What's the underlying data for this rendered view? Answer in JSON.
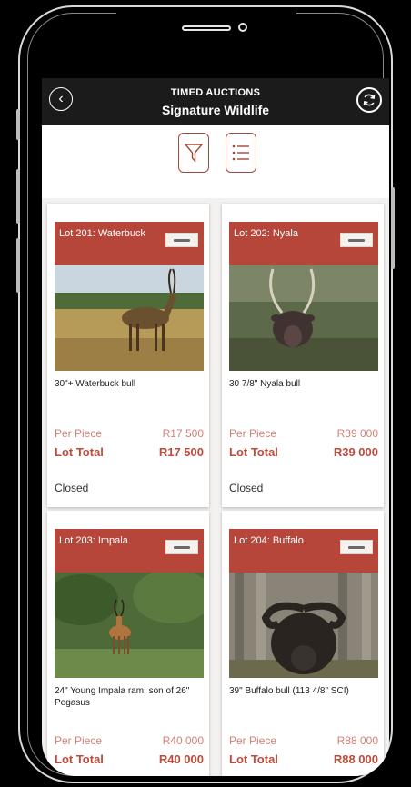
{
  "header": {
    "subtitle": "TIMED AUCTIONS",
    "title": "Signature Wildlife",
    "back_icon": "back-arrow-icon",
    "refresh_icon": "refresh-icon"
  },
  "toolbar": {
    "filter_icon": "filter-icon",
    "list_icon": "list-view-icon"
  },
  "colors": {
    "accent": "#b7463a",
    "header_bg": "#1b1b1b",
    "price": "#c04a3a"
  },
  "lots": [
    {
      "title": "Lot 201: Waterbuck",
      "description": "30\"+ Waterbuck bull",
      "per_piece_label": "Per Piece",
      "per_piece_value": "R17 500",
      "lot_total_label": "Lot Total",
      "lot_total_value": "R17 500",
      "status": "Closed"
    },
    {
      "title": "Lot 202: Nyala",
      "description": "30 7/8\" Nyala bull",
      "per_piece_label": "Per Piece",
      "per_piece_value": "R39 000",
      "lot_total_label": "Lot Total",
      "lot_total_value": "R39 000",
      "status": "Closed"
    },
    {
      "title": "Lot 203: Impala",
      "description": "24\" Young Impala ram, son of 26\" Pegasus",
      "per_piece_label": "Per Piece",
      "per_piece_value": "R40 000",
      "lot_total_label": "Lot Total",
      "lot_total_value": "R40 000",
      "status": ""
    },
    {
      "title": "Lot 204: Buffalo",
      "description": "39\" Buffalo bull (113 4/8\" SCI)",
      "per_piece_label": "Per Piece",
      "per_piece_value": "R88 000",
      "lot_total_label": "Lot Total",
      "lot_total_value": "R88 000",
      "status": ""
    }
  ]
}
